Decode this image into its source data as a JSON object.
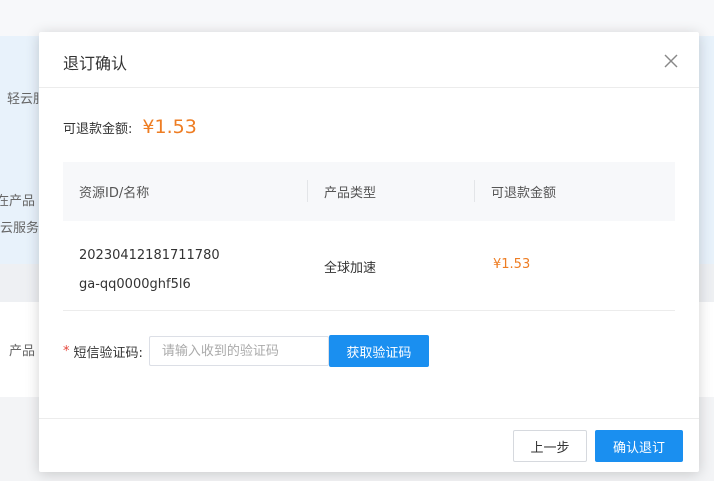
{
  "background": {
    "fragments": [
      "轻云服",
      "在产品",
      "云服务",
      "产品"
    ]
  },
  "modal": {
    "title": "退订确认",
    "close_icon": "close-icon",
    "refund": {
      "label": "可退款金额:",
      "amount": "¥1.53"
    },
    "table": {
      "headers": [
        "资源ID/名称",
        "产品类型",
        "可退款金额"
      ],
      "rows": [
        {
          "resource_id": "20230412181711780",
          "resource_name": "ga-qq0000ghf5l6",
          "product_type": "全球加速",
          "refund_amount": "¥1.53"
        }
      ]
    },
    "sms": {
      "required_mark": "*",
      "label": "短信验证码:",
      "placeholder": "请输入收到的验证码",
      "value": "",
      "get_code_label": "获取验证码"
    },
    "footer": {
      "prev_label": "上一步",
      "confirm_label": "确认退订"
    }
  },
  "colors": {
    "accent": "#1a8ff0",
    "amount": "#ee7d23",
    "required": "#e5453a"
  }
}
